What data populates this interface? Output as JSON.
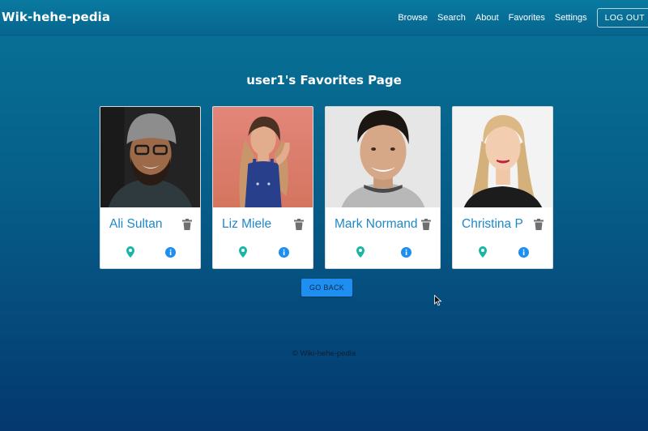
{
  "app": {
    "brand": "Wik-hehe-pedia"
  },
  "nav": {
    "links": [
      "Browse",
      "Search",
      "About",
      "Favorites",
      "Settings"
    ],
    "logout_label": "LOG OUT"
  },
  "page": {
    "title": "user1's Favorites Page"
  },
  "favorites": [
    {
      "name": "Ali Sultan"
    },
    {
      "name": "Liz Miele"
    },
    {
      "name": "Mark Normand"
    },
    {
      "name": "Christina P"
    }
  ],
  "icons": {
    "delete": "trash-icon",
    "location": "map-pin-icon",
    "info": "info-icon"
  },
  "colors": {
    "name_text": "#1e88c8",
    "pin": "#19b6a6",
    "info": "#1e8ff0",
    "trash": "#6f6f6f",
    "button": "#1e8ff0"
  },
  "actions": {
    "go_back_label": "GO BACK"
  },
  "footer": {
    "text": "© Wiki-hehe-pedia"
  }
}
